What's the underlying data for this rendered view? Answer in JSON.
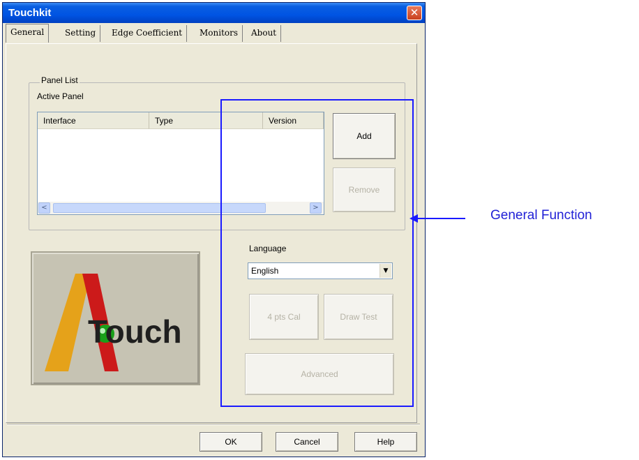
{
  "window": {
    "title": "Touchkit",
    "close_glyph": "✕"
  },
  "tabs": [
    {
      "label": "General",
      "active": true
    },
    {
      "label": "Setting",
      "active": false
    },
    {
      "label": "Edge Coefficient",
      "active": false
    },
    {
      "label": "Monitors",
      "active": false
    },
    {
      "label": "About",
      "active": false
    }
  ],
  "panel_list": {
    "legend": "Panel List",
    "active_panel_label": "Active Panel",
    "columns": [
      "Interface",
      "Type",
      "Version"
    ],
    "scroll_left": "<",
    "scroll_right": ">"
  },
  "buttons": {
    "add": "Add",
    "remove": "Remove",
    "cal": "4 pts Cal",
    "draw_test": "Draw Test",
    "advanced": "Advanced",
    "ok": "OK",
    "cancel": "Cancel",
    "help": "Help"
  },
  "language": {
    "label": "Language",
    "selected": "English"
  },
  "logo": {
    "text": "Touch",
    "letter_mark": "A"
  },
  "annotation": {
    "text": "General Function",
    "color": "#1a1aff"
  }
}
